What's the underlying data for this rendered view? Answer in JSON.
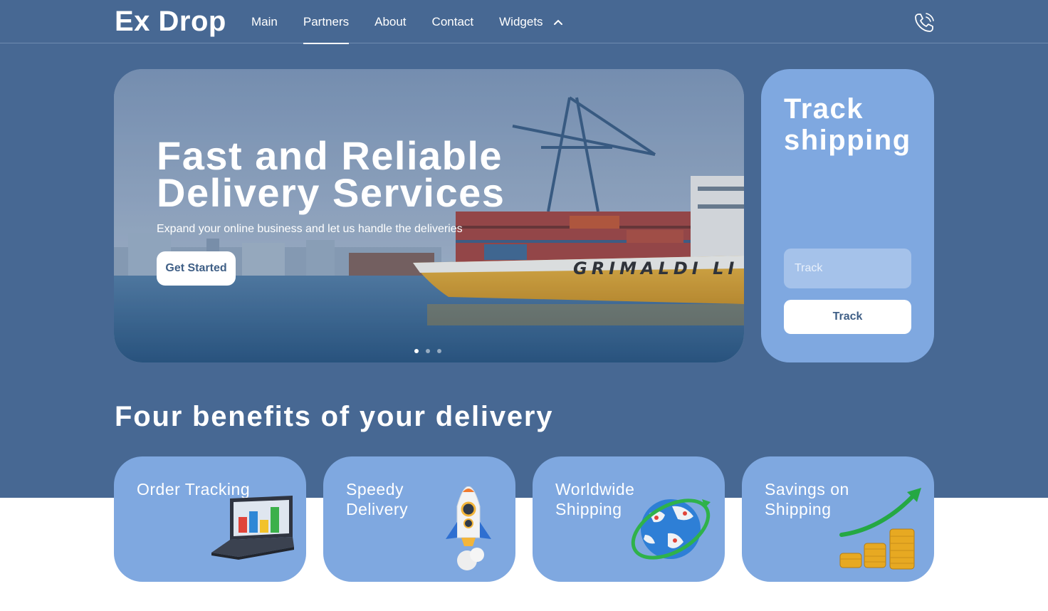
{
  "brand": {
    "name": "Ex Drop"
  },
  "nav": {
    "items": [
      {
        "label": "Main"
      },
      {
        "label": "Partners",
        "active": true
      },
      {
        "label": "About"
      },
      {
        "label": "Contact"
      },
      {
        "label": "Widgets",
        "dropdown": true
      }
    ],
    "phone_icon": "phone-icon",
    "dropdown_icon": "chevron-up-icon"
  },
  "hero": {
    "title": "Fast and Reliable Delivery Services",
    "subtitle": "Expand your online business and let us handle the deliveries",
    "cta_label": "Get Started",
    "ship_name": "GRIMALDI LI",
    "slides_count": 3,
    "active_slide": 1
  },
  "track": {
    "title": "Track shipping",
    "input_placeholder": "Track",
    "button_label": "Track"
  },
  "benefits": {
    "title": "Four benefits of your delivery",
    "cards": [
      {
        "label": "Order Tracking",
        "icon": "laptop-chart-icon"
      },
      {
        "label": "Speedy Delivery",
        "icon": "rocket-icon"
      },
      {
        "label": "Worldwide Shipping",
        "icon": "globe-icon"
      },
      {
        "label": "Savings on Shipping",
        "icon": "coins-growth-icon"
      }
    ]
  },
  "colors": {
    "page_blue": "#476893",
    "card_blue": "#7fa8e0",
    "button_text": "#3f5f86",
    "white": "#ffffff"
  }
}
